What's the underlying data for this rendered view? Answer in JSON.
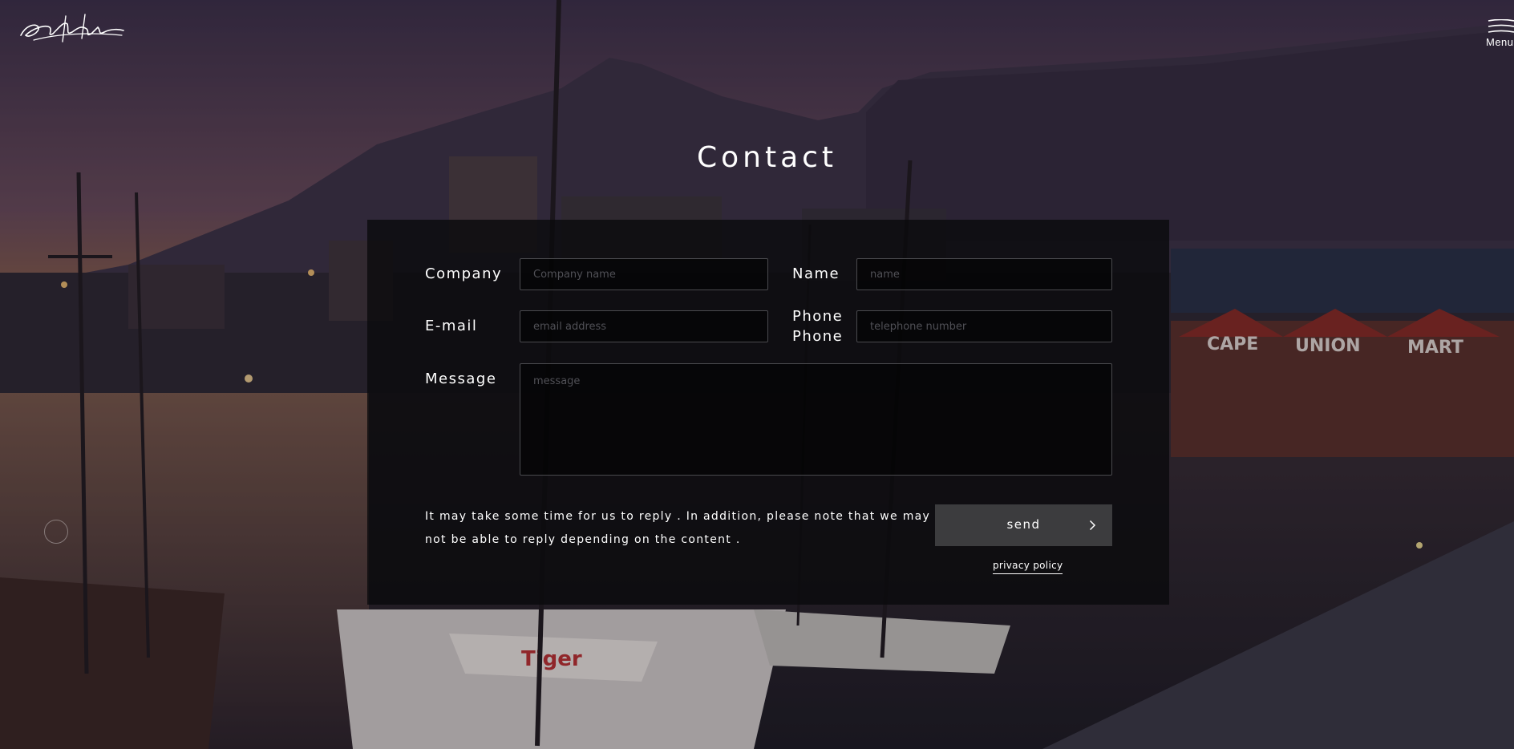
{
  "header": {
    "logo_text": "Yoshino Tomoko",
    "menu_label": "Menu"
  },
  "page": {
    "title": "Contact"
  },
  "form": {
    "company": {
      "label": "Company",
      "placeholder": "Company name"
    },
    "name": {
      "label": "Name",
      "placeholder": "name"
    },
    "email": {
      "label": "E-mail",
      "placeholder": "email address"
    },
    "phone": {
      "label_line1": "Phone",
      "label_line2": "Phone",
      "placeholder": "telephone number"
    },
    "message": {
      "label": "Message",
      "placeholder": "message"
    },
    "note": "It may take some time for us to reply . In addition, please note that we may not be able to reply depending on the content .",
    "send_label": "send",
    "privacy_label": "privacy policy"
  },
  "icons": {
    "menu": "hamburger-icon",
    "send": "chevron-right-icon",
    "logo": "signature-logo"
  },
  "background": {
    "shop_sign": [
      "CAPE",
      "UNION",
      "MART"
    ],
    "boat_text": "Tiger"
  },
  "colors": {
    "panel": "#0a0a0c",
    "text": "#ffffff",
    "button": "#3c3c3e",
    "field_border": "#4a4a4e"
  }
}
